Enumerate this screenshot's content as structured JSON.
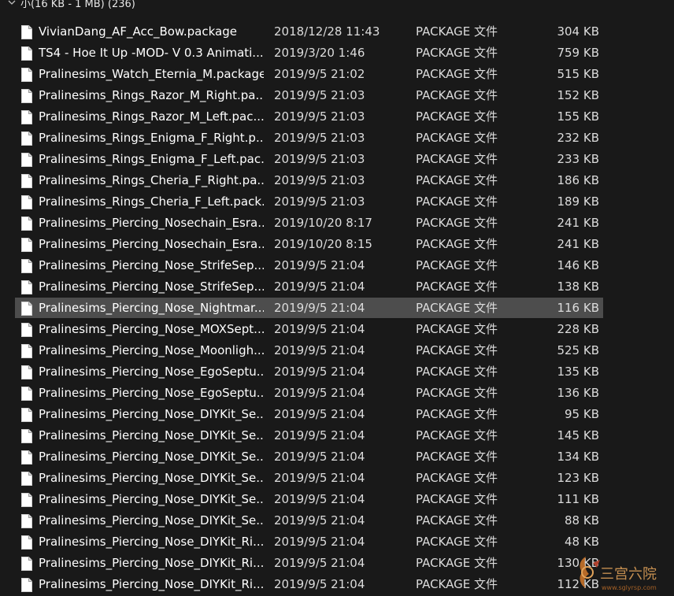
{
  "group": {
    "label": "小(16 KB - 1 MB)  (236)"
  },
  "files": [
    {
      "name": "VivianDang_AF_Acc_Bow.package",
      "date": "2018/12/28 11:43",
      "type": "PACKAGE 文件",
      "size": "304 KB"
    },
    {
      "name": "TS4  - Hoe It Up -MOD- V 0.3 Animati...",
      "date": "2019/3/20 1:46",
      "type": "PACKAGE 文件",
      "size": "759 KB"
    },
    {
      "name": "Pralinesims_Watch_Eternia_M.package",
      "date": "2019/9/5 21:02",
      "type": "PACKAGE 文件",
      "size": "515 KB"
    },
    {
      "name": "Pralinesims_Rings_Razor_M_Right.pa...",
      "date": "2019/9/5 21:03",
      "type": "PACKAGE 文件",
      "size": "152 KB"
    },
    {
      "name": "Pralinesims_Rings_Razor_M_Left.pac...",
      "date": "2019/9/5 21:03",
      "type": "PACKAGE 文件",
      "size": "155 KB"
    },
    {
      "name": "Pralinesims_Rings_Enigma_F_Right.p...",
      "date": "2019/9/5 21:03",
      "type": "PACKAGE 文件",
      "size": "232 KB"
    },
    {
      "name": "Pralinesims_Rings_Enigma_F_Left.pac...",
      "date": "2019/9/5 21:03",
      "type": "PACKAGE 文件",
      "size": "233 KB"
    },
    {
      "name": "Pralinesims_Rings_Cheria_F_Right.pa...",
      "date": "2019/9/5 21:03",
      "type": "PACKAGE 文件",
      "size": "186 KB"
    },
    {
      "name": "Pralinesims_Rings_Cheria_F_Left.pack...",
      "date": "2019/9/5 21:03",
      "type": "PACKAGE 文件",
      "size": "189 KB"
    },
    {
      "name": "Pralinesims_Piercing_Nosechain_Esra...",
      "date": "2019/10/20 8:17",
      "type": "PACKAGE 文件",
      "size": "241 KB"
    },
    {
      "name": "Pralinesims_Piercing_Nosechain_Esra...",
      "date": "2019/10/20 8:15",
      "type": "PACKAGE 文件",
      "size": "241 KB"
    },
    {
      "name": "Pralinesims_Piercing_Nose_StrifeSep...",
      "date": "2019/9/5 21:04",
      "type": "PACKAGE 文件",
      "size": "146 KB"
    },
    {
      "name": "Pralinesims_Piercing_Nose_StrifeSep...",
      "date": "2019/9/5 21:04",
      "type": "PACKAGE 文件",
      "size": "138 KB"
    },
    {
      "name": "Pralinesims_Piercing_Nose_Nightmar...",
      "date": "2019/9/5 21:04",
      "type": "PACKAGE 文件",
      "size": "116 KB",
      "selected": true
    },
    {
      "name": "Pralinesims_Piercing_Nose_MOXSept...",
      "date": "2019/9/5 21:04",
      "type": "PACKAGE 文件",
      "size": "228 KB"
    },
    {
      "name": "Pralinesims_Piercing_Nose_Moonligh...",
      "date": "2019/9/5 21:04",
      "type": "PACKAGE 文件",
      "size": "525 KB"
    },
    {
      "name": "Pralinesims_Piercing_Nose_EgoSeptu...",
      "date": "2019/9/5 21:04",
      "type": "PACKAGE 文件",
      "size": "135 KB"
    },
    {
      "name": "Pralinesims_Piercing_Nose_EgoSeptu...",
      "date": "2019/9/5 21:04",
      "type": "PACKAGE 文件",
      "size": "136 KB"
    },
    {
      "name": "Pralinesims_Piercing_Nose_DIYKit_Se...",
      "date": "2019/9/5 21:04",
      "type": "PACKAGE 文件",
      "size": "95 KB"
    },
    {
      "name": "Pralinesims_Piercing_Nose_DIYKit_Se...",
      "date": "2019/9/5 21:04",
      "type": "PACKAGE 文件",
      "size": "145 KB"
    },
    {
      "name": "Pralinesims_Piercing_Nose_DIYKit_Se...",
      "date": "2019/9/5 21:04",
      "type": "PACKAGE 文件",
      "size": "134 KB"
    },
    {
      "name": "Pralinesims_Piercing_Nose_DIYKit_Se...",
      "date": "2019/9/5 21:04",
      "type": "PACKAGE 文件",
      "size": "123 KB"
    },
    {
      "name": "Pralinesims_Piercing_Nose_DIYKit_Se...",
      "date": "2019/9/5 21:04",
      "type": "PACKAGE 文件",
      "size": "111 KB"
    },
    {
      "name": "Pralinesims_Piercing_Nose_DIYKit_Se...",
      "date": "2019/9/5 21:04",
      "type": "PACKAGE 文件",
      "size": "88 KB"
    },
    {
      "name": "Pralinesims_Piercing_Nose_DIYKit_Ri...",
      "date": "2019/9/5 21:04",
      "type": "PACKAGE 文件",
      "size": "48 KB"
    },
    {
      "name": "Pralinesims_Piercing_Nose_DIYKit_Ri...",
      "date": "2019/9/5 21:04",
      "type": "PACKAGE 文件",
      "size": "130 KB"
    },
    {
      "name": "Pralinesims_Piercing_Nose_DIYKit_Ri...",
      "date": "2019/9/5 21:04",
      "type": "PACKAGE 文件",
      "size": "112 KB"
    }
  ],
  "watermark": {
    "text": "三宫六院",
    "url_text": "www.sglyrsp.com"
  },
  "colors": {
    "background": "#191919",
    "selected_row": "#4d4d4d",
    "text": "#ffffff",
    "watermark_accent": "#c8732a"
  },
  "icons": {
    "file": "file-icon",
    "group_toggle": "chevron-down-icon"
  }
}
